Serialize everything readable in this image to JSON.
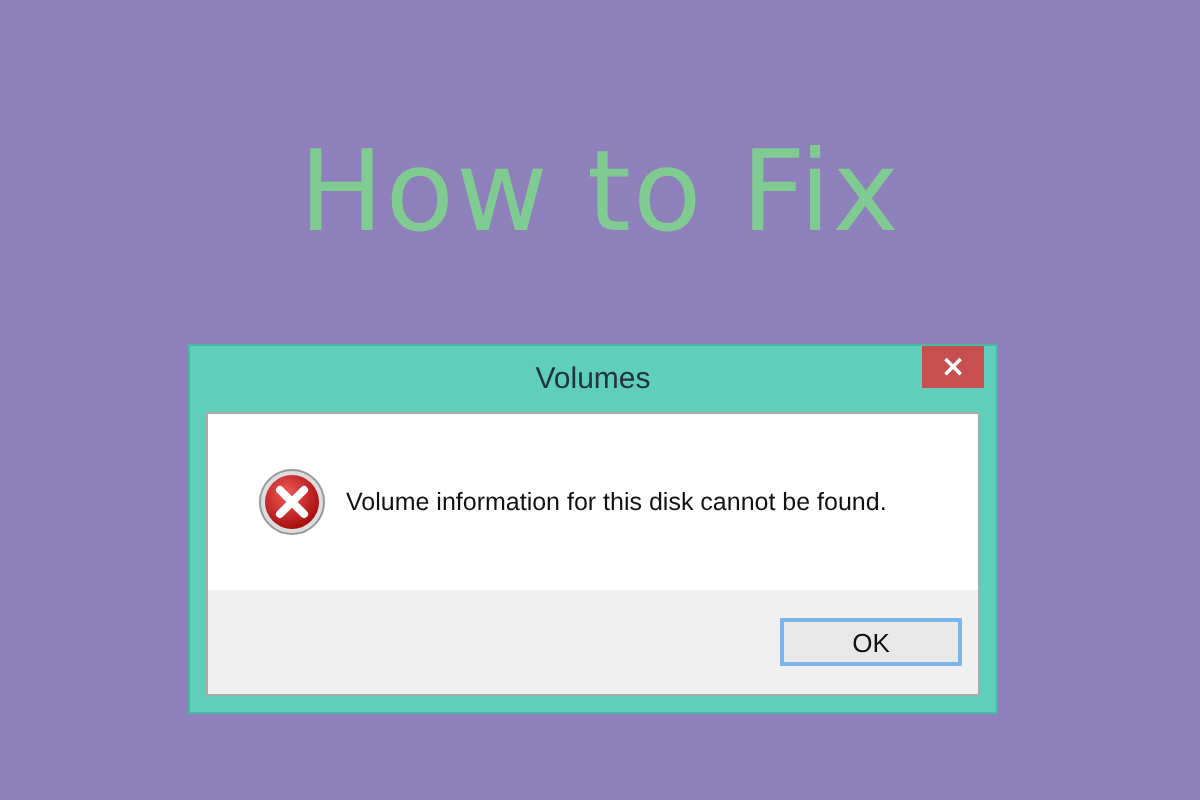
{
  "heading": "How to Fix",
  "window": {
    "title": "Volumes",
    "close": "×"
  },
  "message": "Volume information for this disk cannot be found.",
  "buttons": [
    {
      "label": "OK",
      "focused": true
    }
  ]
}
